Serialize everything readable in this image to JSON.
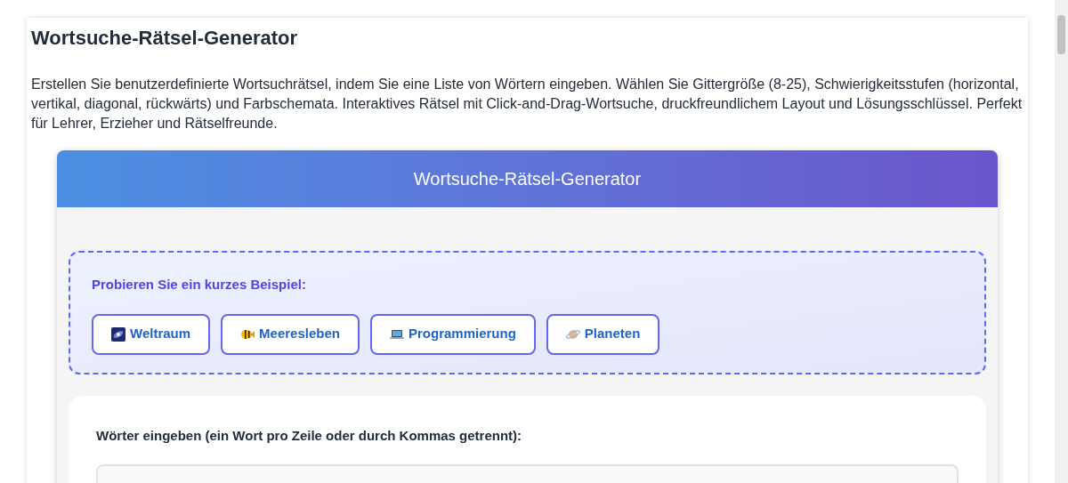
{
  "page": {
    "title": "Wortsuche-Rätsel-Generator",
    "description": "Erstellen Sie benutzerdefinierte Wortsuchrätsel, indem Sie eine Liste von Wörtern eingeben. Wählen Sie Gittergröße (8-25), Schwierigkeitsstufen (horizontal, vertikal, diagonal, rückwärts) und Farbschemata. Interaktives Rätsel mit Click-and-Drag-Wortsuche, druckfreundlichem Layout und Lösungsschlüssel. Perfekt für Lehrer, Erzieher und Rätselfreunde."
  },
  "app": {
    "header": "Wortsuche-Rätsel-Generator",
    "examples": {
      "label": "Probieren Sie ein kurzes Beispiel:",
      "buttons": [
        {
          "kind": "galaxy",
          "label": "Weltraum"
        },
        {
          "kind": "fish",
          "label": "Meeresleben"
        },
        {
          "kind": "laptop",
          "label": "Programmierung"
        },
        {
          "kind": "planet",
          "label": "Planeten"
        }
      ]
    },
    "words_label": "Wörter eingeben (ein Wort pro Zeile oder durch Kommas getrennt):"
  }
}
